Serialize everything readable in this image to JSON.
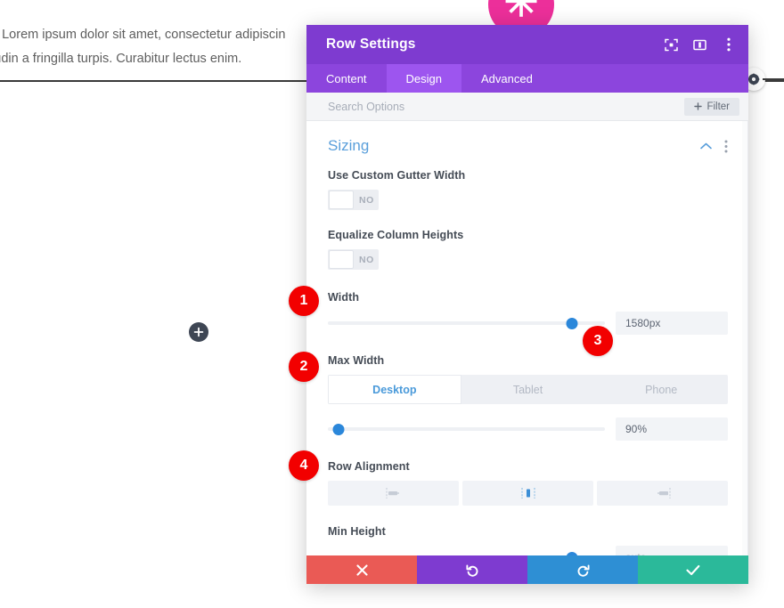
{
  "background": {
    "paragraph_line1": "e. Lorem ipsum dolor sit amet, consectetur adipiscin",
    "paragraph_line2": "itudin a fringilla turpis. Curabitur lectus enim.",
    "flower_glyph": "✳",
    "add_button_icon": "plus-icon",
    "right_circle_icon": "settings-gear-icon"
  },
  "modal": {
    "title": "Row Settings",
    "header_icons": [
      {
        "name": "focus-target-icon",
        "label": "Focus"
      },
      {
        "name": "layout-columns-icon",
        "label": "Layout"
      },
      {
        "name": "more-options-icon",
        "label": "More Options"
      }
    ],
    "tabs": [
      {
        "label": "Content",
        "active": false
      },
      {
        "label": "Design",
        "active": true
      },
      {
        "label": "Advanced",
        "active": false
      }
    ],
    "search": {
      "placeholder": "Search Options",
      "value": ""
    },
    "filter_label": "Filter",
    "section": {
      "title": "Sizing",
      "collapse_icon": "chevron-up-icon",
      "more_icon": "more-options-icon"
    },
    "fields": {
      "gutter": {
        "label": "Use Custom Gutter Width",
        "toggle_value": "NO"
      },
      "equalize": {
        "label": "Equalize Column Heights",
        "toggle_value": "NO"
      },
      "width": {
        "label": "Width",
        "value": "1580px",
        "slider_percent": 88
      },
      "max_width": {
        "label": "Max Width",
        "value": "90%",
        "slider_percent": 4,
        "devices": [
          {
            "label": "Desktop",
            "active": true
          },
          {
            "label": "Tablet",
            "active": false
          },
          {
            "label": "Phone",
            "active": false
          }
        ]
      },
      "row_alignment": {
        "label": "Row Alignment",
        "options": [
          {
            "name": "align-left-icon",
            "active": false
          },
          {
            "name": "align-center-icon",
            "active": true
          },
          {
            "name": "align-right-icon",
            "active": false
          }
        ]
      },
      "min_height": {
        "label": "Min Height",
        "value": "auto",
        "slider_percent": 88
      }
    },
    "footer": [
      {
        "name": "cancel-button",
        "icon": "close-x-icon"
      },
      {
        "name": "undo-button",
        "icon": "undo-arrow-icon"
      },
      {
        "name": "redo-button",
        "icon": "redo-arrow-icon"
      },
      {
        "name": "save-button",
        "icon": "check-icon"
      }
    ]
  },
  "annotations": {
    "badge1": "1",
    "badge2": "2",
    "badge3": "3",
    "badge4": "4"
  },
  "colors": {
    "header_purple": "#7e3bd0",
    "tab_purple": "#8c45dd",
    "accent_blue": "#2b87da",
    "section_blue": "#5a9fdb",
    "badge_red": "#f20000",
    "flower_pink": "#ec2f9a",
    "save_teal": "#2bb99a",
    "cancel_red": "#ea5a55"
  }
}
